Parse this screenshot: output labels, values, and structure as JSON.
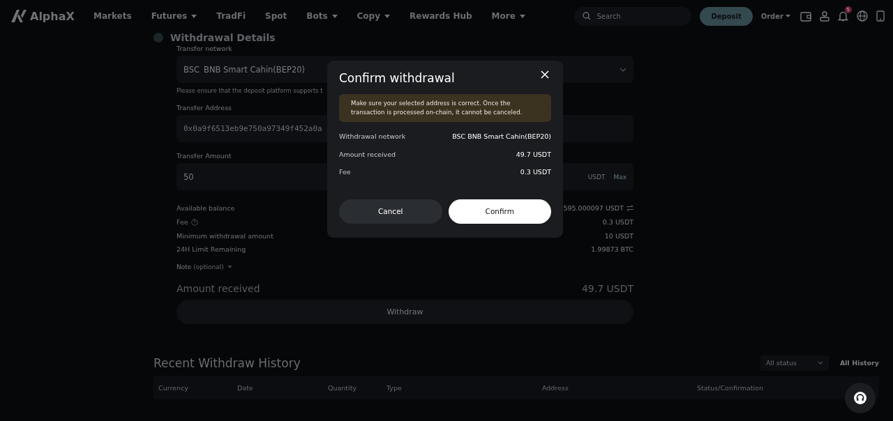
{
  "nav": {
    "logo": "AlphaX",
    "items": [
      {
        "label": "Markets",
        "dropdown": false
      },
      {
        "label": "Futures",
        "dropdown": true
      },
      {
        "label": "TradFi",
        "dropdown": false
      },
      {
        "label": "Spot",
        "dropdown": false
      },
      {
        "label": "Bots",
        "dropdown": true
      },
      {
        "label": "Copy",
        "dropdown": true
      },
      {
        "label": "Rewards Hub",
        "dropdown": false
      },
      {
        "label": "More",
        "dropdown": true
      }
    ],
    "search": {
      "placeholder": "Search"
    },
    "deposit": "Deposit",
    "order": "Order",
    "notification_count": "5"
  },
  "form": {
    "heading": "Withdrawal Details",
    "network_label": "Transfer network",
    "network_code": "BSC",
    "network_name": "BNB Smart Cahin(BEP20)",
    "network_hint": "Please ensure that the deposit platform supports t",
    "address_label": "Transfer Address",
    "address_value": "0x0a9f6513eb9e750a97349f452a0a",
    "amount_label": "Transfer Amount",
    "amount_value": "50",
    "amount_unit": "USDT",
    "max": "Max",
    "details": [
      {
        "label": "Available balance",
        "value": "595.000097 USDT",
        "kind": "swap"
      },
      {
        "label": "Fee",
        "value": "0.3 USDT",
        "kind": "help"
      },
      {
        "label": "Minimum withdrawal amount",
        "value": "10 USDT",
        "kind": "plain"
      },
      {
        "label": "24H Limit Remaining",
        "value": "1.99873 BTC",
        "kind": "plain"
      }
    ],
    "note": "Note",
    "note_optional": "(optional)",
    "received_label": "Amount received",
    "received_value": "49.7 USDT",
    "withdraw": "Withdraw"
  },
  "modal": {
    "title": "Confirm withdrawal",
    "warning": "Make sure your selected address is correct. Once the transaction is processed on-chain, it cannot be canceled.",
    "rows": [
      {
        "label": "Withdrawal network",
        "value": "BSC BNB Smart Cahin(BEP20)"
      },
      {
        "label": "Amount received",
        "value": "49.7 USDT"
      },
      {
        "label": "Fee",
        "value": "0.3 USDT"
      }
    ],
    "cancel": "Cancel",
    "confirm": "Confirm"
  },
  "history": {
    "title": "Recent Withdraw History",
    "status_filter": "All status",
    "all_history": "All History",
    "columns": [
      "Currency",
      "Date",
      "Quantity",
      "Type",
      "Address",
      "Status/Confirmation"
    ]
  }
}
